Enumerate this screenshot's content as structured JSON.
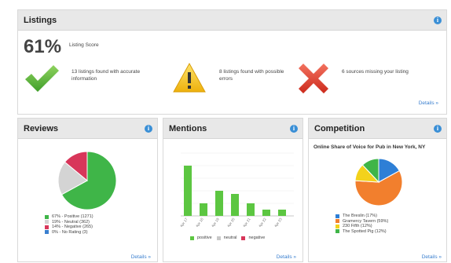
{
  "listings": {
    "title": "Listings",
    "score_value": "61%",
    "score_label": "Listing Score",
    "stats": [
      {
        "text": "13 listings found with accurate information",
        "icon": "check-icon",
        "color": "#56b33f"
      },
      {
        "text": "8 listings found with possible errors",
        "icon": "warning-icon",
        "color": "#f2c314"
      },
      {
        "text": "6 sources missing your listing",
        "icon": "x-icon",
        "color": "#e23c2c"
      }
    ],
    "details": "Details »"
  },
  "reviews": {
    "title": "Reviews",
    "details": "Details »",
    "legend": [
      {
        "label": "67% - Positive (1271)",
        "color": "#3fb548"
      },
      {
        "label": "19% - Neutral (362)",
        "color": "#d4d4d4"
      },
      {
        "label": "14% - Negative (265)",
        "color": "#d8365a"
      },
      {
        "label": "0% - No Rating (3)",
        "color": "#3a7fcf"
      }
    ],
    "chart_data": {
      "type": "pie",
      "labels": [
        "Positive",
        "Neutral",
        "Negative",
        "No Rating"
      ],
      "values": [
        67,
        19,
        14,
        0
      ],
      "colors": [
        "#3fb548",
        "#d4d4d4",
        "#d8365a",
        "#3a7fcf"
      ]
    }
  },
  "mentions": {
    "title": "Mentions",
    "details": "Details »",
    "legend": [
      {
        "label": "positive",
        "color": "#5cc641"
      },
      {
        "label": "neutral",
        "color": "#c8c8c8"
      },
      {
        "label": "negative",
        "color": "#d8365a"
      }
    ],
    "chart_data": {
      "type": "bar",
      "categories": [
        "Apr 17",
        "Apr 18",
        "Apr 19",
        "Apr 20",
        "Apr 21",
        "Apr 22",
        "Apr 23"
      ],
      "series": [
        {
          "name": "positive",
          "values": [
            8,
            2,
            4,
            3.5,
            2,
            1,
            1
          ]
        }
      ],
      "ylim": [
        0,
        10
      ]
    }
  },
  "competition": {
    "title": "Competition",
    "chart_title": "Online Share of Voice for Pub in New York, NY",
    "details": "Details »",
    "legend": [
      {
        "label": "The Breslin (17%)",
        "color": "#2e7fd6"
      },
      {
        "label": "Gramercy Tavern (59%)",
        "color": "#f27f2d"
      },
      {
        "label": "230 Fifth (12%)",
        "color": "#f3d21b"
      },
      {
        "label": "The Spotted Pig (12%)",
        "color": "#3fb548"
      }
    ],
    "chart_data": {
      "type": "pie",
      "labels": [
        "The Breslin",
        "Gramercy Tavern",
        "230 Fifth",
        "The Spotted Pig"
      ],
      "values": [
        17,
        59,
        12,
        12
      ],
      "colors": [
        "#2e7fd6",
        "#f27f2d",
        "#f3d21b",
        "#3fb548"
      ]
    }
  }
}
